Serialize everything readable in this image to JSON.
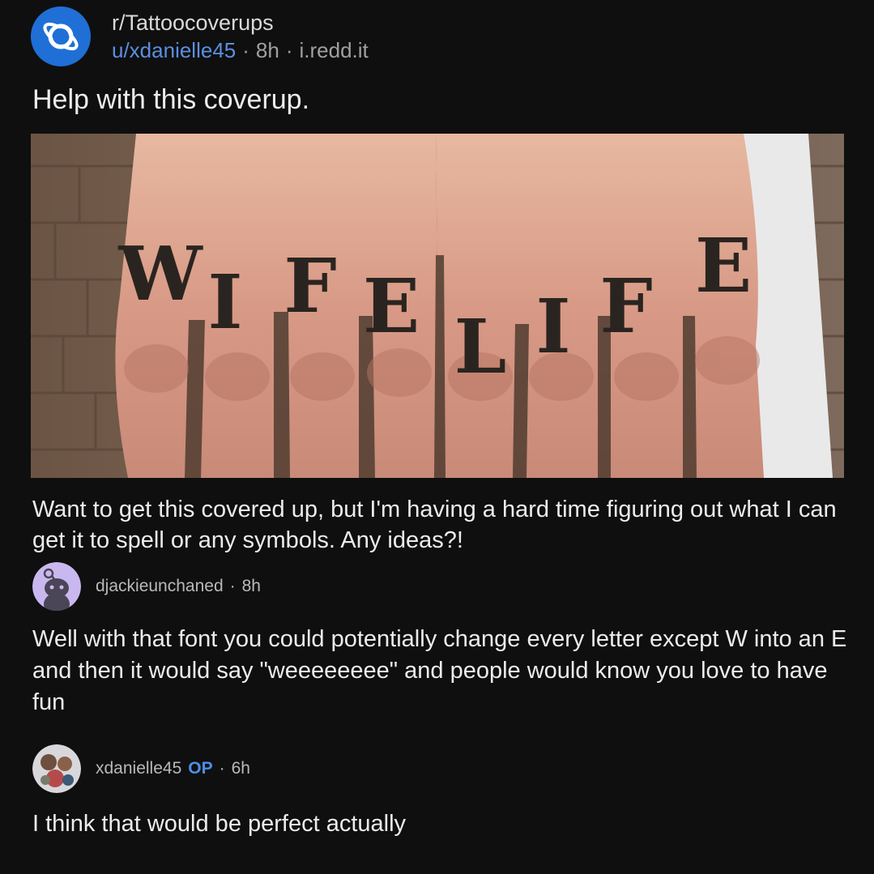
{
  "post": {
    "subreddit": "r/Tattoocoverups",
    "author": "u/xdanielle45",
    "age": "8h",
    "domain": "i.redd.it",
    "title": "Help with this coverup.",
    "image_letters": [
      "W",
      "I",
      "F",
      "E",
      "L",
      "I",
      "F",
      "E"
    ],
    "body": "Want to get this covered up, but I'm having a hard time figuring out what I can get it to spell or any symbols. Any ideas?!"
  },
  "comments": [
    {
      "username": "djackieunchaned",
      "age": "8h",
      "text": "Well with that font you could potentially change every letter except W into an E and then it would say \"weeeeeeee\" and people would know you love to have fun"
    },
    {
      "username": "xdanielle45",
      "op_badge": "OP",
      "age": "6h",
      "text": "I think that would be perfect actually"
    }
  ],
  "colors": {
    "background": "#0f0f0f",
    "subreddit_icon": "#1f6fd6",
    "user_link": "#5b8fe0",
    "op_badge": "#4b8fe6",
    "snoo_avatar": "#c9b8f0"
  },
  "icons": {
    "subreddit": "planet-icon",
    "comment1_avatar": "snoo-avatar-icon",
    "comment2_avatar": "photo-avatar"
  }
}
